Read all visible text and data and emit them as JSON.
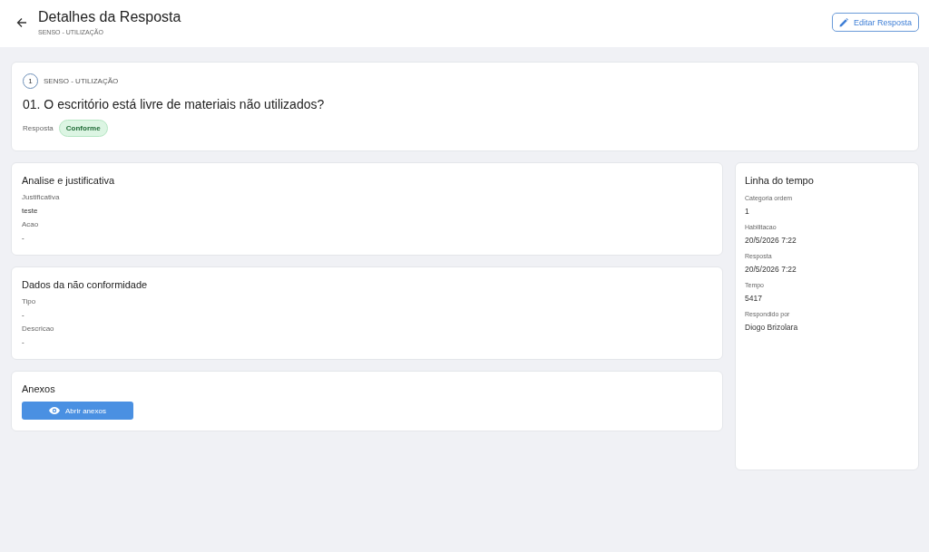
{
  "header": {
    "title": "Detalhes da Resposta",
    "subtitle": "SENSO - UTILIZAÇÃO",
    "edit_button": "Editar Resposta"
  },
  "question": {
    "number": "1",
    "category": "SENSO - UTILIZAÇÃO",
    "text": "01. O escritório está livre de materiais não utilizados?",
    "answer_label": "Resposta",
    "answer": "Conforme"
  },
  "sections": [
    {
      "kind": "fields",
      "title": "Analise e justificativa",
      "fields": [
        {
          "label": "Justificativa",
          "value": "teste"
        },
        {
          "label": "Acao",
          "value": "-"
        }
      ]
    },
    {
      "kind": "fields",
      "title": "Dados da não conformidade",
      "fields": [
        {
          "label": "Tipo",
          "value": "-"
        },
        {
          "label": "Descricao",
          "value": "-"
        }
      ]
    },
    {
      "kind": "attachments",
      "title": "Anexos",
      "button": "Abrir anexos"
    }
  ],
  "timeline": {
    "title": "Linha do tempo",
    "fields": [
      {
        "label": "Categoria ordem",
        "value": "1"
      },
      {
        "label": "Habilitacao",
        "value": "20/5/2026 7:22"
      },
      {
        "label": "Resposta",
        "value": "20/5/2026 7:22"
      },
      {
        "label": "Tempo",
        "value": "5417"
      },
      {
        "label": "Respondido por",
        "value": "Diogo Brizolara"
      }
    ]
  }
}
